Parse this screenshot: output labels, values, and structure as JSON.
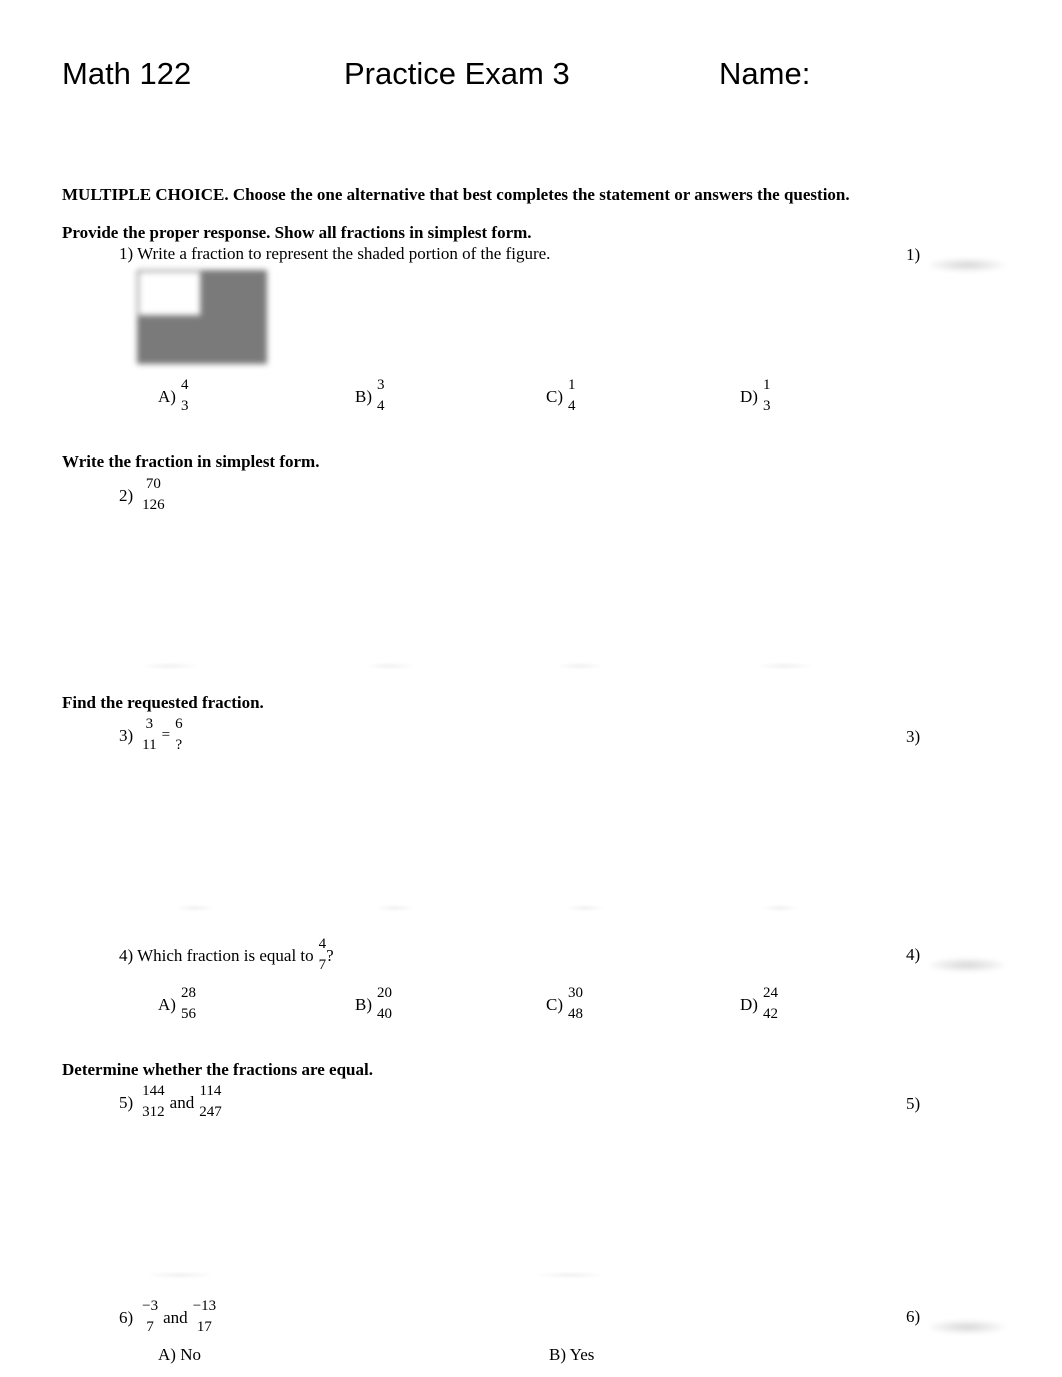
{
  "header": {
    "course": "Math 122",
    "title": "Practice Exam 3",
    "name_label": "Name:"
  },
  "instructions": "MULTIPLE CHOICE. Choose the one alternative that best completes the statement or answers the question.",
  "sections": [
    {
      "heading": "Provide the proper response. Show all fractions in simplest form."
    },
    {
      "heading": "Write the fraction in simplest form."
    },
    {
      "heading": "Find the requested fraction."
    },
    {
      "heading": "Determine whether the fractions are equal."
    }
  ],
  "questions": {
    "q1": {
      "number": "1)",
      "text": "1) Write a fraction to represent the shaded portion of the figure.",
      "figure": {
        "rows": 2,
        "cols": 2,
        "shaded_cells": 3,
        "total_cells": 4,
        "shade_color": "#7a7a7a"
      },
      "choices": [
        {
          "label": "A)",
          "num": "4",
          "den": "3"
        },
        {
          "label": "B)",
          "num": "3",
          "den": "4"
        },
        {
          "label": "C)",
          "num": "1",
          "den": "4"
        },
        {
          "label": "D)",
          "num": "1",
          "den": "3"
        }
      ],
      "answer_marker": "1)"
    },
    "q2": {
      "number": "2)",
      "num": "70",
      "den": "126"
    },
    "q3": {
      "number": "3)",
      "left_num": "3",
      "left_den": "11",
      "equals": "=",
      "right_num": "6",
      "right_den": "?",
      "answer_marker": "3)"
    },
    "q4": {
      "text": "4) Which fraction is equal to",
      "num": "4",
      "den": "7",
      "suffix": "?",
      "choices": [
        {
          "label": "A)",
          "num": "28",
          "den": "56"
        },
        {
          "label": "B)",
          "num": "20",
          "den": "40"
        },
        {
          "label": "C)",
          "num": "30",
          "den": "48"
        },
        {
          "label": "D)",
          "num": "24",
          "den": "42"
        }
      ],
      "answer_marker": "4)"
    },
    "q5": {
      "number": "5)",
      "a_num": "144",
      "a_den": "312",
      "and": "and",
      "b_num": "114",
      "b_den": "247",
      "answer_marker": "5)"
    },
    "q6": {
      "number": "6)",
      "a_num": "−3",
      "a_den": "7",
      "and": "and",
      "b_num": "−13",
      "b_den": "17",
      "choices": [
        {
          "label": "A) No"
        },
        {
          "label": "B) Yes"
        }
      ],
      "answer_marker": "6)"
    }
  }
}
